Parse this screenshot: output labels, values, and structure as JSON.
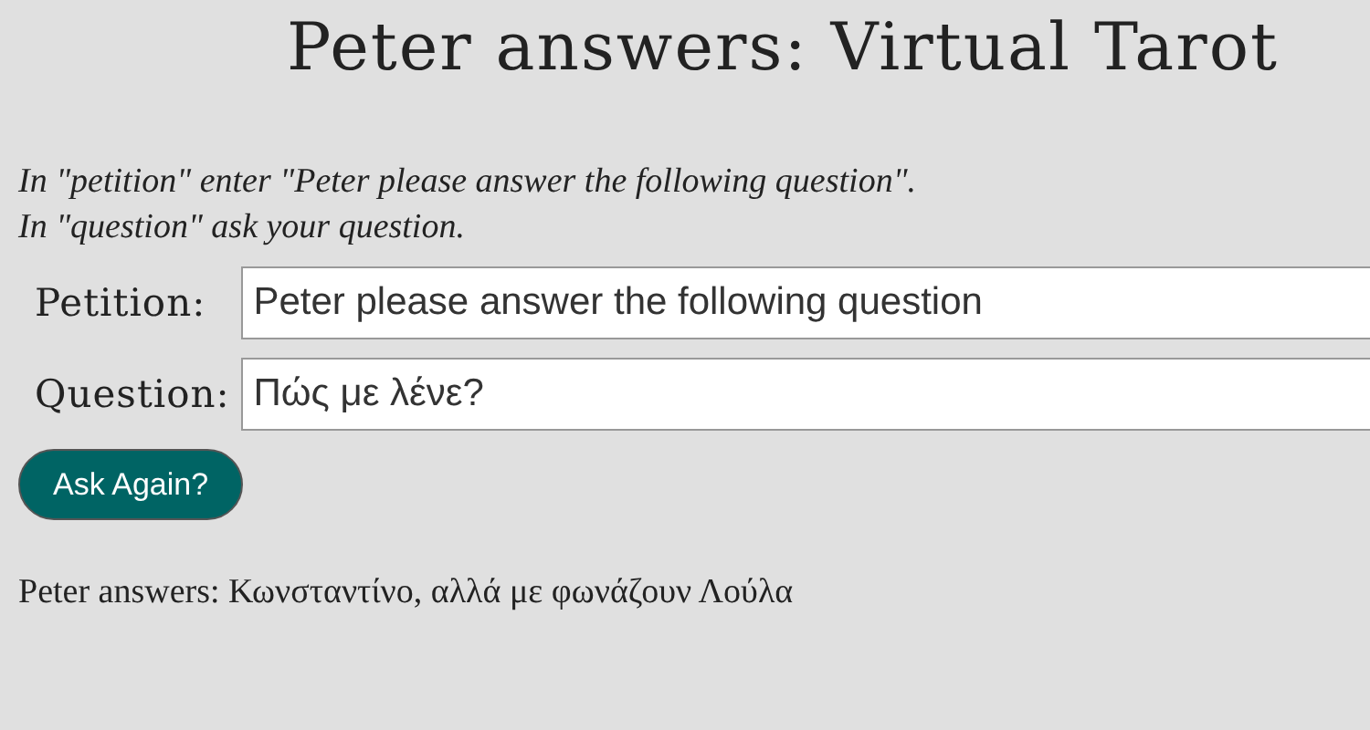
{
  "title": "Peter answers: Virtual Tarot",
  "instructions": [
    "In \"petition\" enter \"Peter please answer the following question\".",
    "In \"question\" ask your question."
  ],
  "fields": [
    {
      "label": "Petition:",
      "value": "Peter please answer the following question"
    },
    {
      "label": "Question:",
      "value": "Πώς με λένε?"
    }
  ],
  "button": "Ask Again?",
  "answer": "Peter answers: Κωνσταντίνο, αλλά με φωνάζουν Λούλα"
}
